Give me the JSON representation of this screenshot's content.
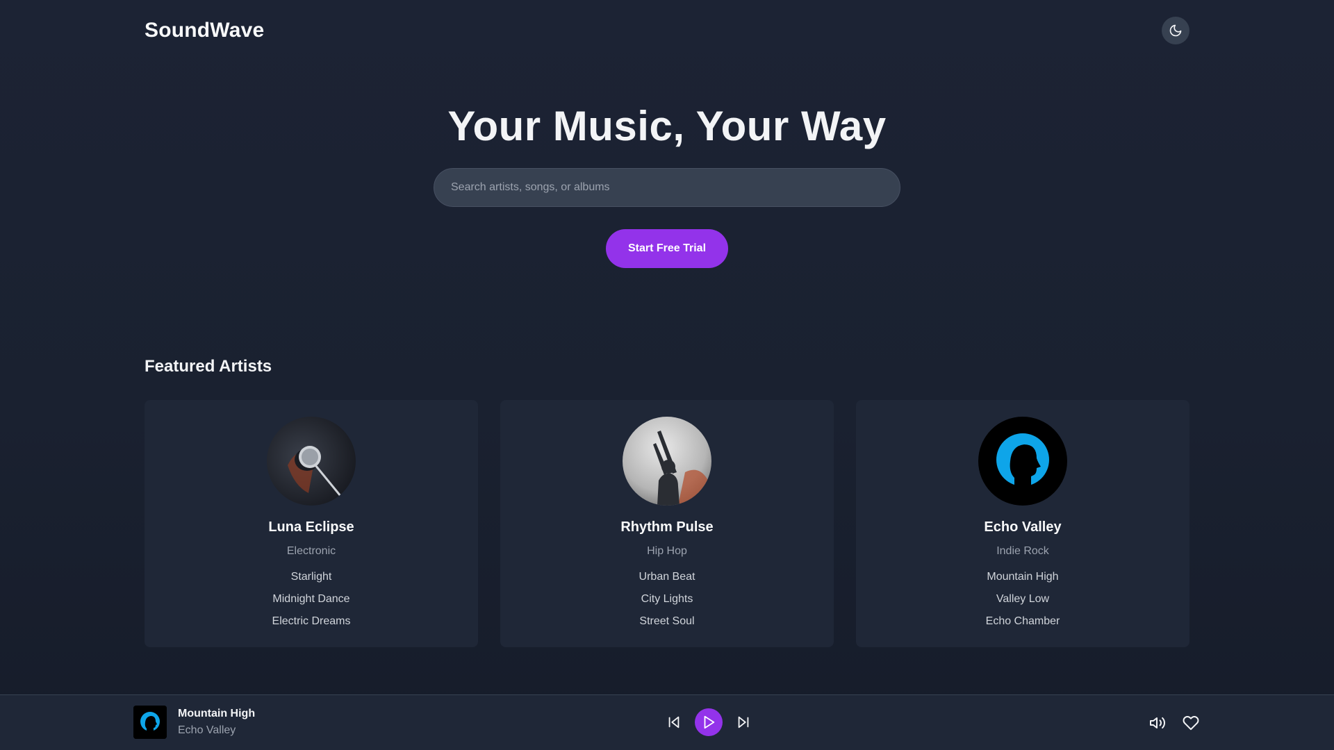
{
  "app": {
    "name": "SoundWave"
  },
  "icons": {
    "theme_toggle": "moon-icon",
    "previous": "skip-back-icon",
    "play": "play-icon",
    "next": "skip-forward-icon",
    "volume": "volume-icon",
    "like": "heart-icon"
  },
  "colors": {
    "accent": "#9333ea",
    "background": "#1a2130",
    "card": "#1f2737",
    "input": "#374151"
  },
  "hero": {
    "title": "Your Music, Your Way",
    "search_placeholder": "Search artists, songs, or albums",
    "cta_label": "Start Free Trial"
  },
  "featured": {
    "title": "Featured Artists",
    "artists": [
      {
        "name": "Luna Eclipse",
        "genre": "Electronic",
        "tracks": [
          "Starlight",
          "Midnight Dance",
          "Electric Dreams"
        ]
      },
      {
        "name": "Rhythm Pulse",
        "genre": "Hip Hop",
        "tracks": [
          "Urban Beat",
          "City Lights",
          "Street Soul"
        ]
      },
      {
        "name": "Echo Valley",
        "genre": "Indie Rock",
        "tracks": [
          "Mountain High",
          "Valley Low",
          "Echo Chamber"
        ]
      }
    ]
  },
  "player": {
    "now_playing": {
      "title": "Mountain High",
      "artist": "Echo Valley"
    }
  }
}
